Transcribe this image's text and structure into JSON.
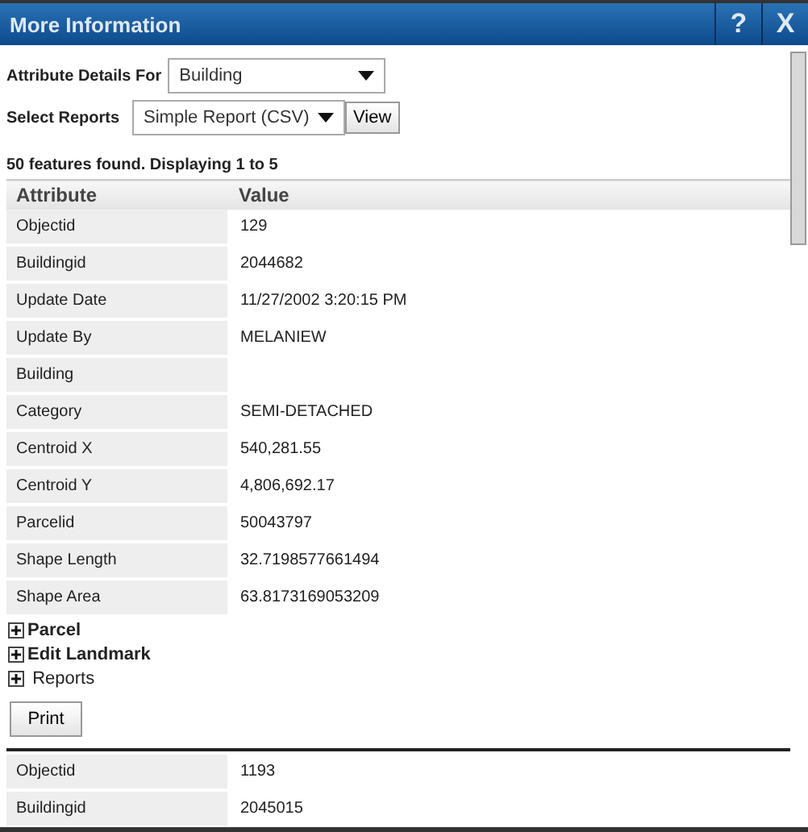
{
  "window": {
    "title": "More Information",
    "help": "?",
    "close": "X"
  },
  "attribute_details_for": {
    "label": "Attribute Details For",
    "value": "Building"
  },
  "select_reports": {
    "label": "Select Reports",
    "value": "Simple Report (CSV)",
    "button": "View"
  },
  "summary": "50 features found. Displaying 1 to 5",
  "table": {
    "columns": [
      "Attribute",
      "Value"
    ],
    "rows": [
      [
        "Objectid",
        "129"
      ],
      [
        "Buildingid",
        "2044682"
      ],
      [
        "Update Date",
        "11/27/2002 3:20:15 PM"
      ],
      [
        "Update By",
        "MELANIEW"
      ],
      [
        "Building",
        ""
      ],
      [
        "Category",
        "SEMI-DETACHED"
      ],
      [
        "Centroid X",
        "540,281.55"
      ],
      [
        "Centroid Y",
        "4,806,692.17"
      ],
      [
        "Parcelid",
        "50043797"
      ],
      [
        "Shape Length",
        "32.7198577661494"
      ],
      [
        "Shape Area",
        "63.8173169053209"
      ]
    ]
  },
  "sections": [
    {
      "label": "Parcel",
      "kind": "related",
      "expanded": false
    },
    {
      "label": "Edit Landmark",
      "kind": "related",
      "expanded": false
    },
    {
      "label": "Reports",
      "kind": "reports",
      "expanded": false
    }
  ],
  "print_button": "Print",
  "next_table": {
    "rows": [
      [
        "Objectid",
        "1193"
      ],
      [
        "Buildingid",
        "2045015"
      ]
    ]
  }
}
